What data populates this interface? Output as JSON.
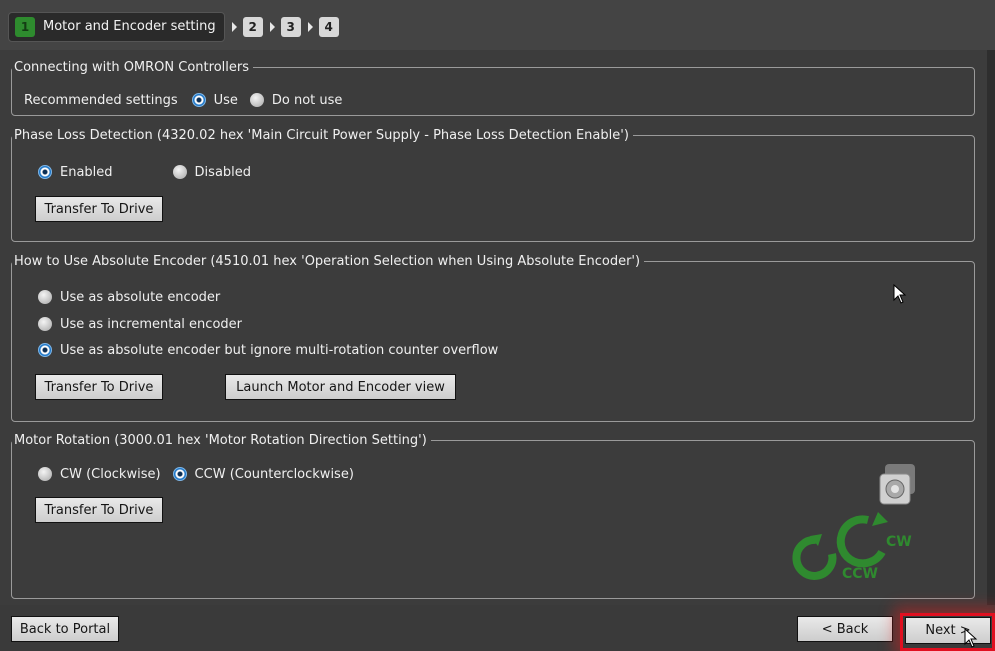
{
  "wizard": {
    "steps": [
      {
        "number": "1",
        "label": "Motor and Encoder setting"
      },
      {
        "number": "2"
      },
      {
        "number": "3"
      },
      {
        "number": "4"
      }
    ]
  },
  "omron": {
    "title": "Connecting with OMRON Controllers",
    "label": "Recommended settings",
    "options": [
      "Use",
      "Do not use"
    ],
    "selected": "Use"
  },
  "phase_loss": {
    "title": "Phase Loss Detection (4320.02 hex 'Main Circuit Power Supply - Phase Loss Detection Enable')",
    "options": [
      "Enabled",
      "Disabled"
    ],
    "selected": "Enabled",
    "transfer_label": "Transfer To Drive"
  },
  "abs_encoder": {
    "title": "How to Use Absolute Encoder (4510.01 hex 'Operation Selection when Using Absolute Encoder')",
    "options": [
      "Use as absolute encoder",
      "Use as incremental encoder",
      "Use as absolute encoder but ignore multi-rotation counter overflow"
    ],
    "selected": "Use as absolute encoder but ignore multi-rotation counter overflow",
    "transfer_label": "Transfer To Drive",
    "launch_label": "Launch Motor and Encoder view"
  },
  "motor_rotation": {
    "title": "Motor Rotation (3000.01 hex 'Motor Rotation Direction Setting')",
    "options": [
      "CW (Clockwise)",
      "CCW (Counterclockwise)"
    ],
    "selected": "CCW (Counterclockwise)",
    "transfer_label": "Transfer To Drive",
    "graphic_labels": {
      "cw": "CW",
      "ccw": "CCW"
    }
  },
  "footer": {
    "back_to_portal": "Back to Portal",
    "back": "< Back",
    "next": "Next >"
  },
  "colors": {
    "background": "#3c3c3c",
    "accent_green": "#2e8b2e",
    "radio_selected": "#1f77c8",
    "highlight_red": "#e01020"
  }
}
